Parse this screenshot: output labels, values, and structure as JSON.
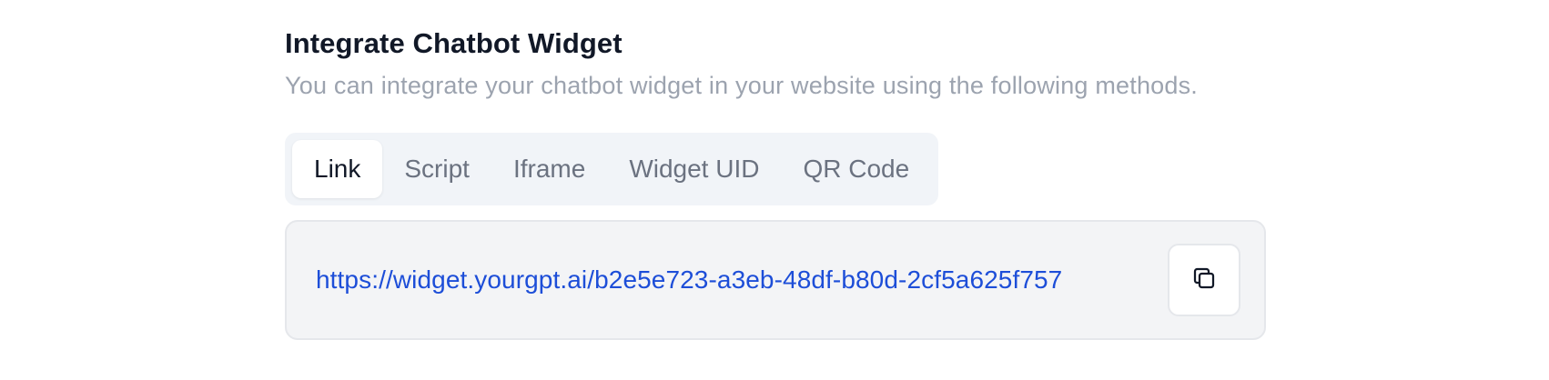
{
  "header": {
    "title": "Integrate Chatbot Widget",
    "subtitle": "You can integrate your chatbot widget in your website using the following methods."
  },
  "tabs": [
    {
      "label": "Link",
      "active": true
    },
    {
      "label": "Script",
      "active": false
    },
    {
      "label": "Iframe",
      "active": false
    },
    {
      "label": "Widget UID",
      "active": false
    },
    {
      "label": "QR Code",
      "active": false
    }
  ],
  "link_panel": {
    "url": "https://widget.yourgpt.ai/b2e5e723-a3eb-48df-b80d-2cf5a625f757",
    "copy_icon": "copy-icon"
  },
  "colors": {
    "link": "#1d4ed8",
    "title": "#111827",
    "subtitle": "#9ca3af",
    "tab_bar_bg": "#f1f4f8",
    "panel_bg": "#f3f4f6"
  }
}
